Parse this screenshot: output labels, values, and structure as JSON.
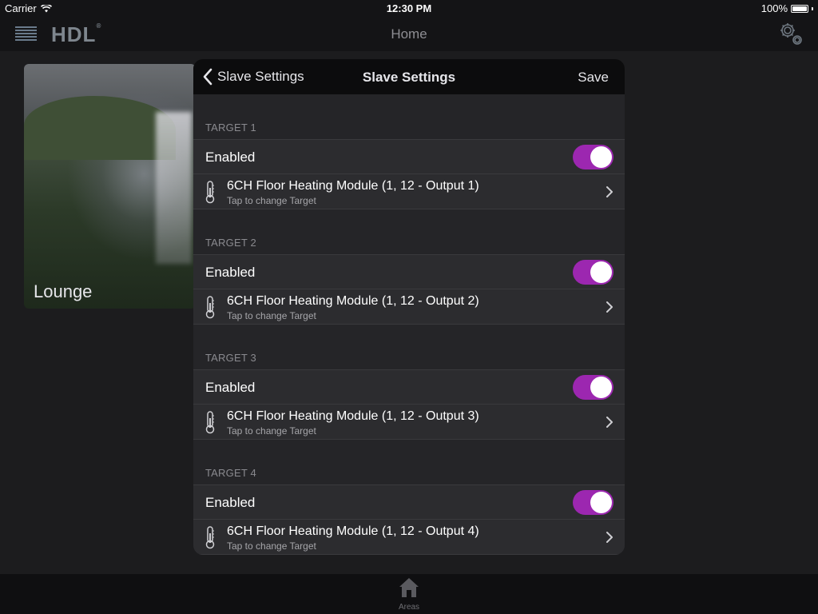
{
  "status_bar": {
    "carrier": "Carrier",
    "time": "12:30 PM",
    "battery": "100%"
  },
  "nav": {
    "logo": "HDL",
    "title": "Home"
  },
  "area_card": {
    "label": "Lounge"
  },
  "modal": {
    "back_label": "Slave Settings",
    "title": "Slave Settings",
    "save_label": "Save",
    "accent_color": "#9c27b0",
    "targets": [
      {
        "header": "TARGET 1",
        "enabled_label": "Enabled",
        "enabled": true,
        "device": "6CH Floor Heating Module (1, 12 - Output 1)",
        "hint": "Tap to change Target"
      },
      {
        "header": "TARGET 2",
        "enabled_label": "Enabled",
        "enabled": true,
        "device": "6CH Floor Heating Module (1, 12 - Output 2)",
        "hint": "Tap to change Target"
      },
      {
        "header": "TARGET 3",
        "enabled_label": "Enabled",
        "enabled": true,
        "device": "6CH Floor Heating Module (1, 12 - Output 3)",
        "hint": "Tap to change Target"
      },
      {
        "header": "TARGET 4",
        "enabled_label": "Enabled",
        "enabled": true,
        "device": "6CH Floor Heating Module (1, 12 - Output 4)",
        "hint": "Tap to change Target"
      }
    ]
  },
  "tab_bar": {
    "areas_label": "Areas"
  },
  "icons": [
    "wifi-icon",
    "battery-icon",
    "menu-icon",
    "gear-icon",
    "back-chevron-icon",
    "thermometer-icon",
    "chevron-right-icon",
    "home-icon"
  ]
}
